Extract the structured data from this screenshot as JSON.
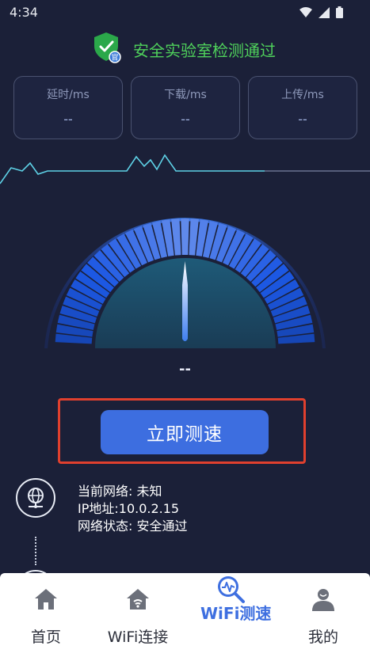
{
  "status_bar": {
    "time": "4:34"
  },
  "security": {
    "text": "安全实验室检测通过",
    "badge": "官"
  },
  "metrics": [
    {
      "label": "延时/ms",
      "value": "--"
    },
    {
      "label": "下载/ms",
      "value": "--"
    },
    {
      "label": "上传/ms",
      "value": "--"
    }
  ],
  "gauge": {
    "reading": "--",
    "level": 0
  },
  "start_button": {
    "label": "立即测速"
  },
  "network": {
    "current_network": "当前网络: 未知",
    "ip": "IP地址:10.0.2.15",
    "state": "网络状态: 安全通过"
  },
  "colors": {
    "background": "#1b2038",
    "accent": "#3d6ee0",
    "success": "#4fd15b",
    "highlight": "#e0402e"
  },
  "bottom_nav": {
    "items": [
      {
        "label": "首页",
        "icon": "home-icon",
        "active": false
      },
      {
        "label": "WiFi连接",
        "icon": "wifi-house-icon",
        "active": false
      },
      {
        "label": "WiFi测速",
        "icon": "speed-search-icon",
        "active": true
      },
      {
        "label": "我的",
        "icon": "user-icon",
        "active": false
      }
    ]
  }
}
